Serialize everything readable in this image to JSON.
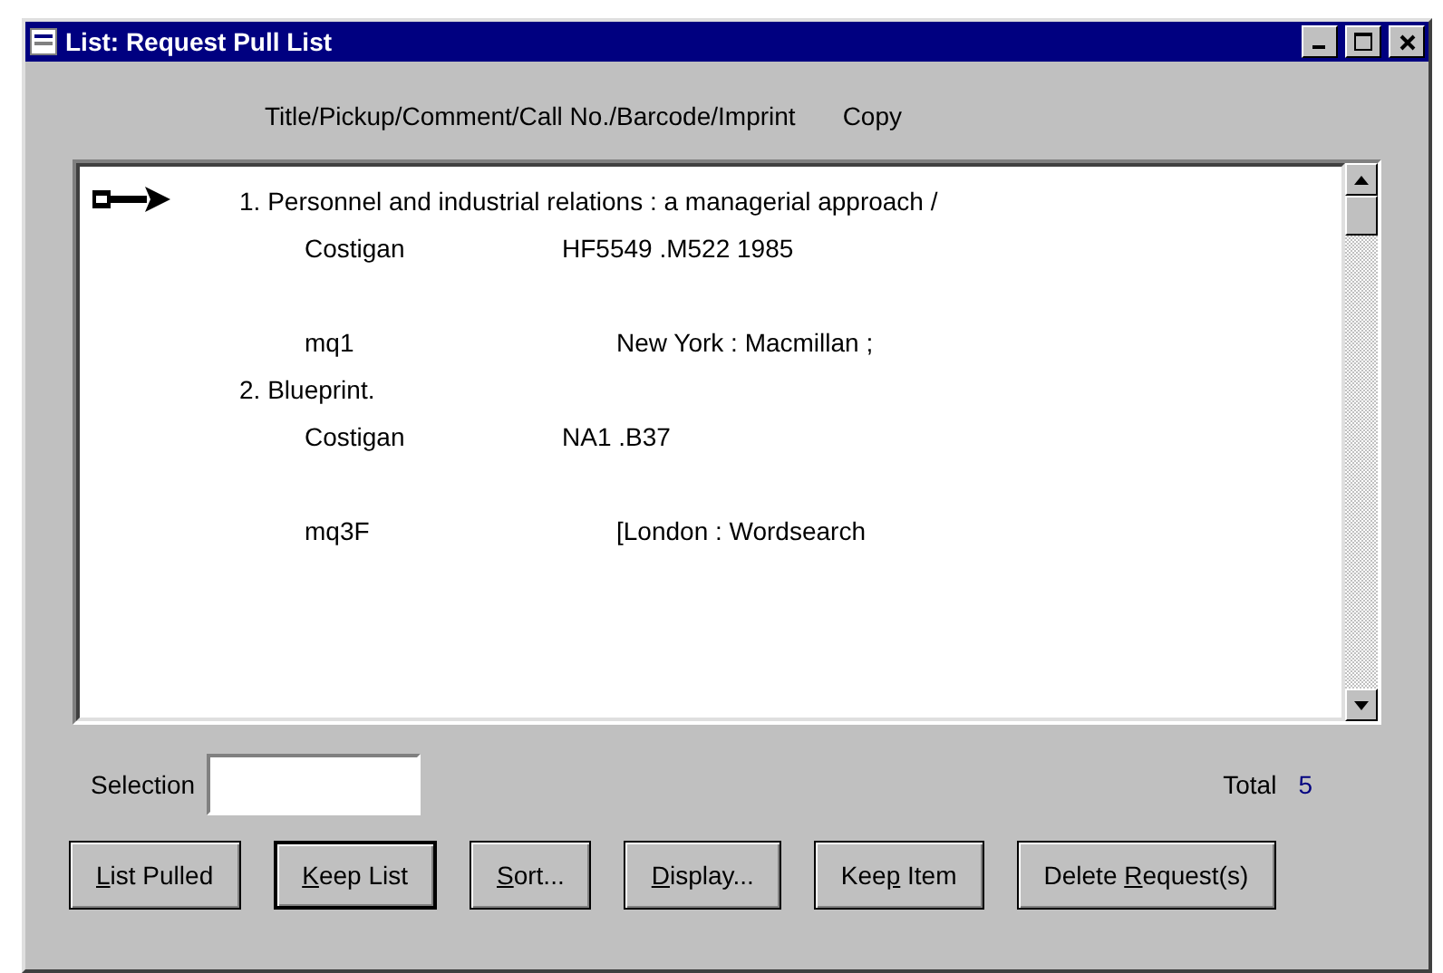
{
  "window": {
    "title": "List: Request Pull List"
  },
  "header": {
    "fields": "Title/Pickup/Comment/Call No./Barcode/Imprint",
    "copy": "Copy"
  },
  "items": [
    {
      "number": "1.",
      "title": "Personnel and industrial relations : a managerial approach /",
      "pickup": "Costigan",
      "call_no": "HF5549 .M522 1985",
      "comment": "mq1",
      "imprint": "New York : Macmillan ;",
      "current": true
    },
    {
      "number": "2.",
      "title": "Blueprint.",
      "pickup": "Costigan",
      "call_no": "NA1 .B37",
      "comment": "mq3F",
      "imprint": "[London : Wordsearch",
      "current": false
    }
  ],
  "selection": {
    "label": "Selection"
  },
  "total": {
    "label": "Total",
    "value": "5"
  },
  "buttons": [
    {
      "key": "L",
      "after": "ist Pulled",
      "default": false
    },
    {
      "key": "K",
      "after": "eep List",
      "default": true
    },
    {
      "key": "S",
      "after": "ort...",
      "default": false
    },
    {
      "key": "D",
      "after": "isplay...",
      "default": false
    },
    {
      "before": "Kee",
      "key": "p",
      "after": " Item",
      "default": false
    },
    {
      "before": "Delete ",
      "key": "R",
      "after": "equest(s)",
      "default": false
    }
  ]
}
